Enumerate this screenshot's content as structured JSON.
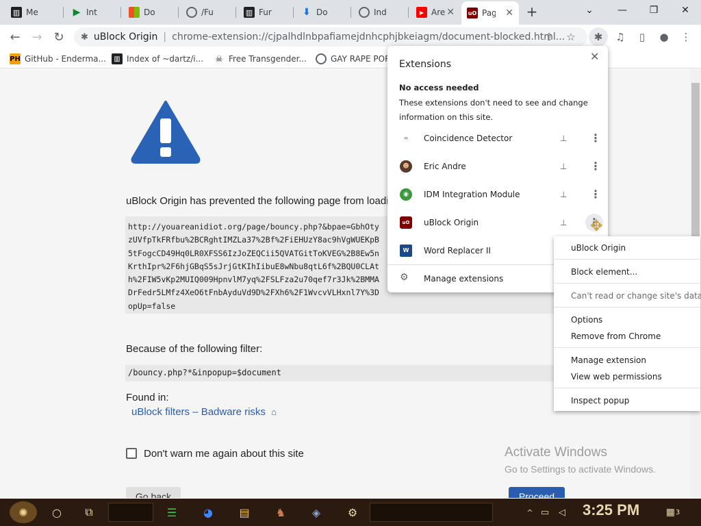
{
  "tabs": [
    {
      "label": "Me",
      "icon": "museum-icon"
    },
    {
      "label": "Int",
      "icon": "play-icon"
    },
    {
      "label": "Do",
      "icon": "windows-icon"
    },
    {
      "label": "/Fu",
      "icon": "globe-icon"
    },
    {
      "label": "Fur",
      "icon": "museum-icon"
    },
    {
      "label": "Do",
      "icon": "download-icon"
    },
    {
      "label": "Ind",
      "icon": "globe-icon"
    },
    {
      "label": "Are",
      "icon": "youtube-icon"
    },
    {
      "label": "Pag",
      "icon": "ublock-icon",
      "active": true
    }
  ],
  "toolbar": {
    "origin": "uBlock Origin",
    "url": "chrome-extension://cjpalhdlnbpafiamejdnhcphjbkeiagm/document-blocked.html..."
  },
  "bookmarks": [
    {
      "label": "GitHub - Enderma...",
      "icon": "ph-icon"
    },
    {
      "label": "Index of ~dartz/i...",
      "icon": "museum-icon"
    },
    {
      "label": "Free Transgender...",
      "icon": "skull-icon"
    },
    {
      "label": "GAY RAPE POR",
      "icon": "globe-icon"
    }
  ],
  "page": {
    "prevented_text": "uBlock Origin has prevented the following page from loadi",
    "blocked_url_lines": [
      "http://youareanidiot.org/page/bouncy.php?&bpae=GbhOty",
      "zUVfpTkFRfbu%2BCRghtIMZLa37%2Bf%2FiEHUzY8ac9hVgWUEKpB",
      "5tFogcCD49Hq0LR0XFSS6IzJoZEQCii5QVATGitToKVEG%2B8Ew5n",
      "KrthIpr%2F6hjGBqS5sJrjGtKIhIibuE8wNbu8qtL6f%2BQU0CLAt",
      "h%2FIW5vKp2MUIQ009HpnvlM7yq%2FSLFza2u70qef7r3Jk%2BMMA",
      "DrFedr5LMfz4XeO6tFnbAyduVd9D%2FXh6%2F1WvcvVLHxnl7Y%3D",
      "opUp=false"
    ],
    "filter_heading": "Because of the following filter:",
    "filter": "/bouncy.php?*&inpopup=$document",
    "found_in": "Found in:",
    "filter_list": "uBlock filters – Badware risks",
    "dont_warn": "Don't warn me again about this site",
    "go_back": "Go back",
    "proceed": "Proceed",
    "activate_title": "Activate Windows",
    "activate_sub": "Go to Settings to activate Windows."
  },
  "extensions_popup": {
    "title": "Extensions",
    "subtitle": "No access needed",
    "description": "These extensions don't need to see and change information on this site.",
    "items": [
      {
        "name": "Coincidence Detector",
        "icon": "glasses-icon"
      },
      {
        "name": "Eric Andre",
        "icon": "avatar-icon"
      },
      {
        "name": "IDM Integration Module",
        "icon": "idm-icon"
      },
      {
        "name": "uBlock Origin",
        "icon": "ublock-icon"
      },
      {
        "name": "Word Replacer II",
        "icon": "wr-icon"
      }
    ],
    "manage_label": "Manage extensions"
  },
  "context_menu": {
    "title": "uBlock Origin",
    "block_element": "Block element...",
    "cant_read": "Can't read or change site's data",
    "options": "Options",
    "remove": "Remove from Chrome",
    "manage_extension": "Manage extension",
    "view_permissions": "View web permissions",
    "inspect_popup": "Inspect popup"
  },
  "taskbar": {
    "clock": "3:25 PM",
    "notification_count": "3"
  },
  "colors": {
    "warning_blue": "#2a63b6",
    "link_blue": "#2a5db0",
    "ublock_red": "#800000"
  }
}
